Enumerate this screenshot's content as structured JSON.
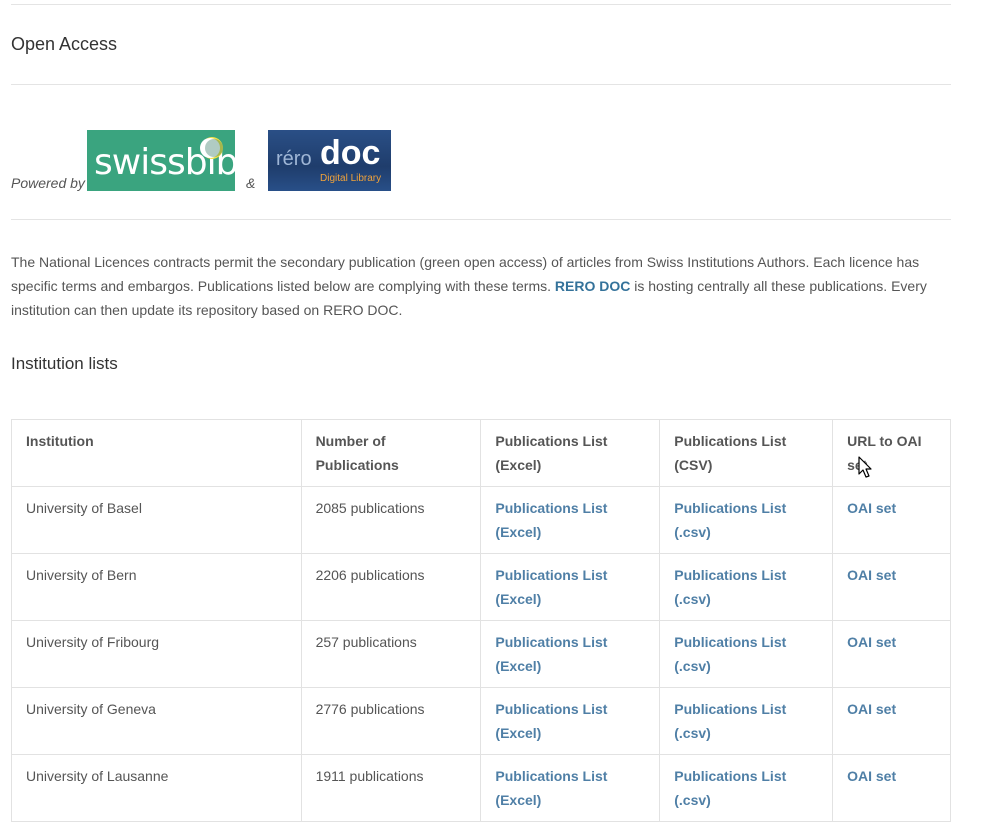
{
  "page": {
    "section_title": "Open Access",
    "powered_by": "Powered by",
    "ampersand": "&",
    "logos": {
      "swissbib": "swissbib",
      "rero_prefix": "réro",
      "rero_main": "doc",
      "rero_sub": "Digital Library"
    },
    "intro": {
      "part1": "The National Licences contracts permit the secondary publication (green open access) of articles from Swiss Institutions Authors. Each licence has specific terms and embargos. Publications listed below are complying with these terms. ",
      "link": "RERO DOC",
      "part2": " is hosting centrally all these publications. Every institution can then update its repository based on RERO DOC."
    },
    "institution_lists_title": "Institution lists"
  },
  "table": {
    "headers": [
      "Institution",
      "Number of Publications",
      "Publications List (Excel)",
      "Publications List (CSV)",
      "URL to OAI set"
    ],
    "rows": [
      {
        "institution": "University of Basel",
        "count": "2085 publications",
        "excel": "Publications List (Excel)",
        "csv": "Publications List (.csv)",
        "oai": "OAI set"
      },
      {
        "institution": "University of Bern",
        "count": "2206 publications",
        "excel": "Publications List (Excel)",
        "csv": "Publications List (.csv)",
        "oai": "OAI set"
      },
      {
        "institution": "University of Fribourg",
        "count": "257 publications",
        "excel": "Publications List (Excel)",
        "csv": "Publications List (.csv)",
        "oai": "OAI set"
      },
      {
        "institution": "University of Geneva",
        "count": "2776 publications",
        "excel": "Publications List (Excel)",
        "csv": "Publications List (.csv)",
        "oai": "OAI set"
      },
      {
        "institution": "University of Lausanne",
        "count": "1911 publications",
        "excel": "Publications List (Excel)",
        "csv": "Publications List (.csv)",
        "oai": "OAI set"
      }
    ]
  },
  "colors": {
    "link": "#4f7fa6",
    "swissbib_green": "#3aa47f",
    "rero_blue": "#2a4f86",
    "border": "#e2e2e2"
  },
  "icons": [
    "mouse-cursor-icon"
  ]
}
